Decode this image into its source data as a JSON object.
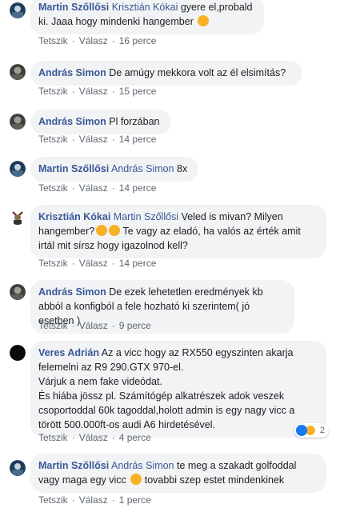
{
  "colors": {
    "name": "#385898",
    "bubble": "#f2f3f5",
    "meta": "#606770",
    "like": "#1877f2",
    "emoji": "#f7b125"
  },
  "actions": {
    "like": "Tetszik",
    "reply": "Válasz"
  },
  "comments": [
    {
      "author": "Martin Szőllősi",
      "mention": "Krisztián Kókai",
      "text": "gyere el,probald ki. Jaaa hogy mindenki hangember",
      "emoji": "sad-face-emoji",
      "time": "16 perce",
      "avatar": "martin"
    },
    {
      "author": "András Simon",
      "mention": "",
      "text": "De amúgy mekkora volt az él elsimítás?",
      "time": "15 perce",
      "avatar": "andras"
    },
    {
      "author": "András Simon",
      "mention": "",
      "text": "Pl forzában",
      "time": "14 perce",
      "avatar": "andras"
    },
    {
      "author": "Martin Szőllősi",
      "mention": "András Simon",
      "text": "8x",
      "time": "14 perce",
      "avatar": "martin"
    },
    {
      "author": "Krisztián Kókai",
      "mention": "Martin Szőllősi",
      "text_a": "Veled is mivan? Milyen hangember?",
      "text_b": "Te vagy az eladó, ha valós az érték amit irtál mit sírsz hogy igazolnod kell?",
      "emoji": "rofl-emoji",
      "time": "14 perce",
      "avatar": "krisztian"
    },
    {
      "author": "András Simon",
      "mention": "",
      "text": "De ezek lehetetlen eredmények kb abból a konfigból a fele hozható ki szerintem( jó esetben )",
      "time": "9 perce",
      "avatar": "andras"
    },
    {
      "author": "Veres Adrián",
      "mention": "",
      "line1": "Az a vicc hogy az RX550 egyszinten akarja felemelni az R9 290.GTX 970-el.",
      "line2": "Várjuk a nem fake videódat.",
      "line3": "És hiába jössz pl. Számítógép alkatrészek adok veszek csoportoddal 60k tagoddal,holott admin is egy nagy vicc a törött 500.000ft-os audi A6 hirdetésével.",
      "time": "4 perce",
      "avatar": "veres",
      "reactions": {
        "like_icon": "like-reaction-icon",
        "haha_icon": "haha-reaction-icon",
        "count": "2"
      }
    },
    {
      "author": "Martin Szőllősi",
      "mention": "András Simon",
      "text_a": "te meg a szakadt golfoddal vagy maga egy vicc",
      "text_b": "tovabbi szep estet mindenkinek",
      "emoji": "smile-emoji",
      "time": "1 perce",
      "avatar": "martin"
    }
  ]
}
